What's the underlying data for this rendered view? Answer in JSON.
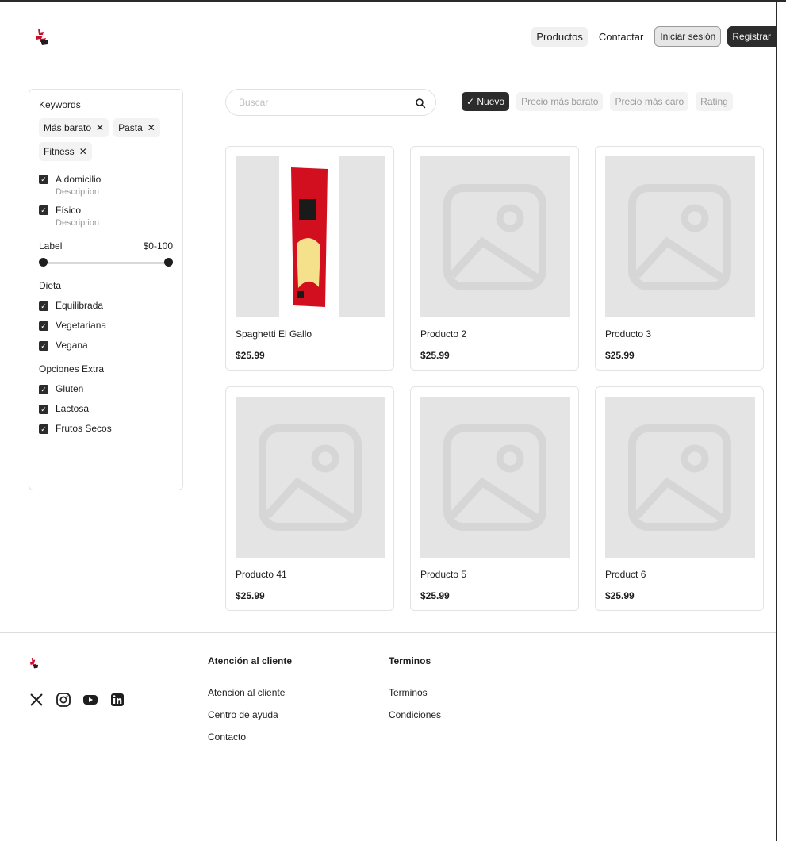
{
  "header": {
    "nav": [
      "Productos",
      "Contactar"
    ],
    "login_label": "Iniciar sesión",
    "register_label": "Registrar"
  },
  "sidebar": {
    "keywords_title": "Keywords",
    "tags": [
      "Más barato",
      "Pasta",
      "Fitness"
    ],
    "delivery_options": [
      {
        "label": "A domicilio",
        "description": "Description",
        "checked": true
      },
      {
        "label": "Físico",
        "description": "Description",
        "checked": true
      }
    ],
    "range": {
      "label": "Label",
      "value_text": "$0-100",
      "min": 0,
      "max": 100
    },
    "diet_title": "Dieta",
    "diet_options": [
      "Equilibrada",
      "Vegetariana",
      "Vegana"
    ],
    "extra_title": "Opciones Extra",
    "extra_options": [
      "Gluten",
      "Lactosa",
      "Frutos Secos"
    ]
  },
  "search": {
    "placeholder": "Buscar"
  },
  "sort": {
    "options": [
      "Nuevo",
      "Precio más barato",
      "Precio más caro",
      "Rating"
    ],
    "active": "Nuevo"
  },
  "products": [
    {
      "name": "Spaghetti El Gallo",
      "price": "$25.99",
      "image": "spaghetti-package"
    },
    {
      "name": "Producto 2",
      "price": "$25.99",
      "image": "placeholder"
    },
    {
      "name": "Producto 3",
      "price": "$25.99",
      "image": "placeholder"
    },
    {
      "name": "Producto 41",
      "price": "$25.99",
      "image": "placeholder"
    },
    {
      "name": "Producto 5",
      "price": "$25.99",
      "image": "placeholder"
    },
    {
      "name": "Product 6",
      "price": "$25.99",
      "image": "placeholder"
    }
  ],
  "footer": {
    "socials": [
      "x-icon",
      "instagram-icon",
      "youtube-icon",
      "linkedin-icon"
    ],
    "columns": [
      {
        "title": "Atención al cliente",
        "links": [
          "Atencion al cliente",
          "Centro de ayuda",
          "Contacto"
        ]
      },
      {
        "title": "Terminos",
        "links": [
          "Terminos",
          "Condiciones"
        ]
      }
    ]
  },
  "colors": {
    "dark": "#2c2c2c",
    "chip_bg": "#f3f3f3",
    "placeholder_bg": "#e4e4e4",
    "brand_red": "#c8102e"
  }
}
